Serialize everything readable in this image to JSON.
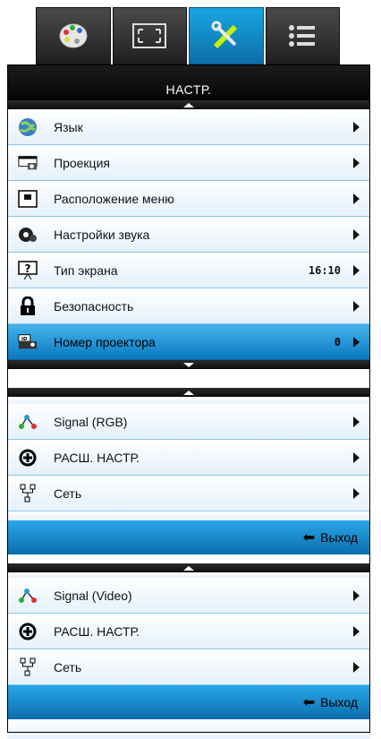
{
  "tabs": [
    {
      "icon": "palette-icon"
    },
    {
      "icon": "screen-fit-icon"
    },
    {
      "icon": "settings-tools-icon"
    },
    {
      "icon": "menu-list-icon"
    }
  ],
  "title": "НАСТР.",
  "main_menu": {
    "items": [
      {
        "label": "Язык",
        "value": "",
        "icon": "globe-icon"
      },
      {
        "label": "Проекция",
        "value": "",
        "icon": "projector-icon"
      },
      {
        "label": "Расположение меню",
        "value": "",
        "icon": "menu-location-icon"
      },
      {
        "label": "Настройки звука",
        "value": "",
        "icon": "sound-settings-icon"
      },
      {
        "label": "Тип экрана",
        "value": "16:10",
        "icon": "screen-type-icon"
      },
      {
        "label": "Безопасность",
        "value": "",
        "icon": "lock-icon"
      },
      {
        "label": "Номер проектора",
        "value": "0",
        "icon": "projector-id-icon"
      }
    ]
  },
  "rgb_menu": {
    "items": [
      {
        "label": "Signal (RGB)",
        "icon": "signal-icon"
      },
      {
        "label": "РАСШ. НАСТР.",
        "icon": "advanced-settings-icon"
      },
      {
        "label": "Сеть",
        "icon": "network-icon"
      }
    ],
    "exit": "Выход"
  },
  "video_menu": {
    "items": [
      {
        "label": "Signal (Video)",
        "icon": "signal-icon"
      },
      {
        "label": "РАСШ. НАСТР.",
        "icon": "advanced-settings-icon"
      },
      {
        "label": "Сеть",
        "icon": "network-icon"
      }
    ],
    "exit": "Выход"
  }
}
